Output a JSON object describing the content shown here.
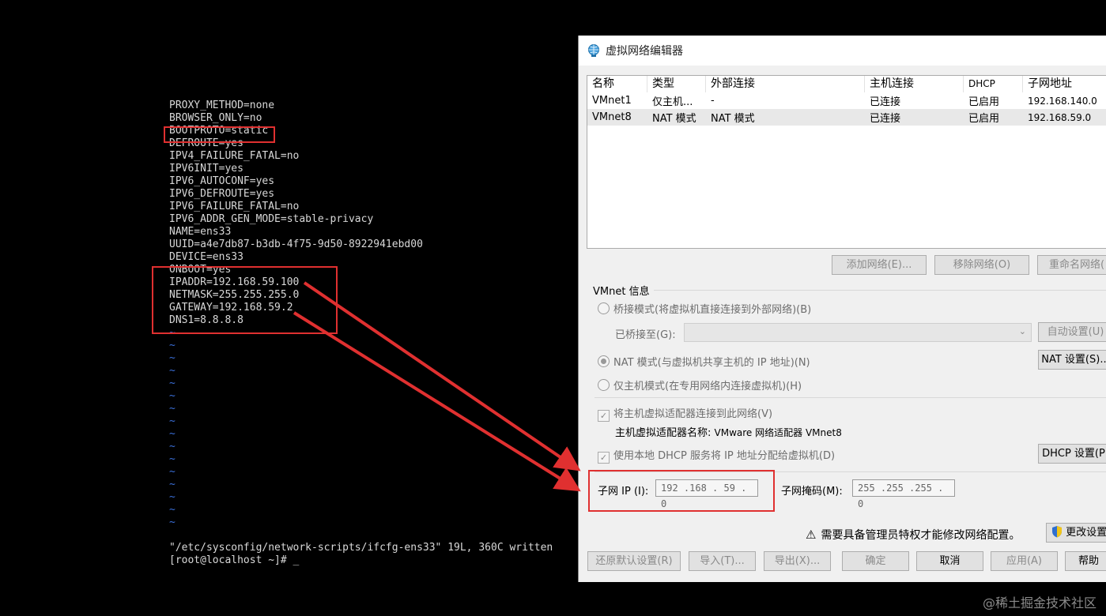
{
  "terminal": {
    "lines": [
      "PROXY_METHOD=none",
      "BROWSER_ONLY=no",
      "BOOTPROTO=static",
      "DEFROUTE=yes",
      "IPV4_FAILURE_FATAL=no",
      "IPV6INIT=yes",
      "IPV6_AUTOCONF=yes",
      "IPV6_DEFROUTE=yes",
      "IPV6_FAILURE_FATAL=no",
      "IPV6_ADDR_GEN_MODE=stable-privacy",
      "NAME=ens33",
      "UUID=a4e7db87-b3db-4f75-9d50-8922941ebd00",
      "DEVICE=ens33",
      "ONBOOT=yes",
      "IPADDR=192.168.59.100",
      "NETMASK=255.255.255.0",
      "GATEWAY=192.168.59.2",
      "DNS1=8.8.8.8"
    ],
    "tilde": "~",
    "tilde_count": 16,
    "status_line": "\"/etc/sysconfig/network-scripts/ifcfg-ens33\" 19L, 360C written",
    "prompt": "[root@localhost ~]# _"
  },
  "dialog": {
    "title": "虚拟网络编辑器",
    "columns": [
      "名称",
      "类型",
      "外部连接",
      "主机连接",
      "DHCP",
      "子网地址"
    ],
    "rows": [
      {
        "name": "VMnet1",
        "type": "仅主机...",
        "external": "-",
        "host": "已连接",
        "dhcp": "已启用",
        "subnet": "192.168.140.0"
      },
      {
        "name": "VMnet8",
        "type": "NAT 模式",
        "external": "NAT 模式",
        "host": "已连接",
        "dhcp": "已启用",
        "subnet": "192.168.59.0"
      }
    ],
    "buttons": {
      "add": "添加网络(E)...",
      "remove": "移除网络(O)",
      "rename": "重命名网络(",
      "auto": "自动设置(U)",
      "nat_settings": "NAT 设置(S)...",
      "dhcp_settings": "DHCP 设置(P)",
      "change_settings": "更改设置",
      "restore": "还原默认设置(R)",
      "import": "导入(T)...",
      "export": "导出(X)...",
      "ok": "确定",
      "cancel": "取消",
      "apply": "应用(A)",
      "help": "帮助"
    },
    "vmnet_info": "VMnet 信息",
    "bridge_mode": "桥接模式(将虚拟机直接连接到外部网络)(B)",
    "bridged_to": "已桥接至(G):",
    "nat_mode": "NAT 模式(与虚拟机共享主机的 IP 地址)(N)",
    "host_only": "仅主机模式(在专用网络内连接虚拟机)(H)",
    "connect_adapter": "将主机虚拟适配器连接到此网络(V)",
    "adapter_name_label": "主机虚拟适配器名称:",
    "adapter_name": "VMware 网络适配器 VMnet8",
    "use_dhcp": "使用本地 DHCP 服务将 IP 地址分配给虚拟机(D)",
    "subnet_ip_label": "子网 IP (I):",
    "subnet_ip": "192 .168 . 59  .  0",
    "subnet_mask_label": "子网掩码(M):",
    "subnet_mask": "255 .255 .255 .  0",
    "admin_warning": "需要具备管理员特权才能修改网络配置。"
  },
  "watermark": "@稀土掘金技术社区",
  "colors": {
    "highlight": "#e03030",
    "tilde": "#3a6fd8"
  }
}
